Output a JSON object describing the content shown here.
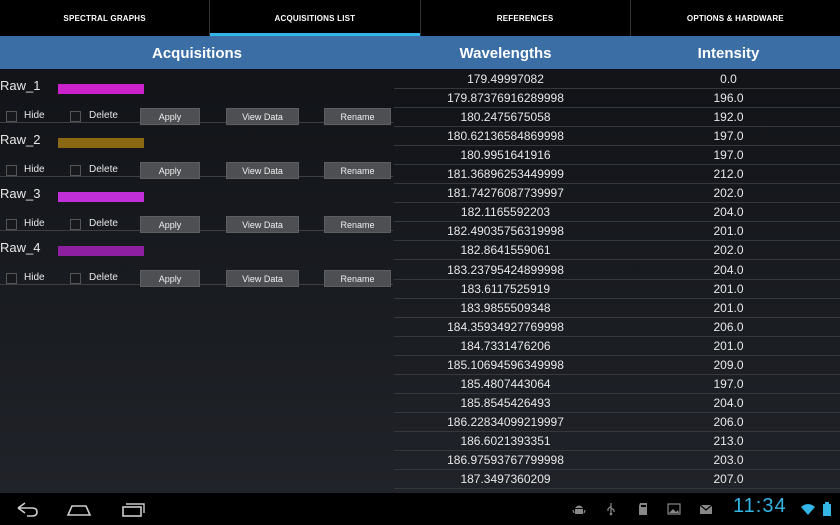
{
  "tabs": [
    {
      "label": "SPECTRAL GRAPHS",
      "active": false
    },
    {
      "label": "ACQUISITIONS LIST",
      "active": true
    },
    {
      "label": "REFERENCES",
      "active": false
    },
    {
      "label": "OPTIONS & HARDWARE",
      "active": false
    }
  ],
  "headers": {
    "acquisitions": "Acquisitions",
    "wavelengths": "Wavelengths",
    "intensity": "Intensity"
  },
  "labels": {
    "hide": "Hide",
    "delete": "Delete",
    "apply": "Apply",
    "view_data": "View Data",
    "rename": "Rename"
  },
  "acquisitions": [
    {
      "name": "Raw_1",
      "color": "#cc22cc"
    },
    {
      "name": "Raw_2",
      "color": "#8b6914"
    },
    {
      "name": "Raw_3",
      "color": "#c02fd8"
    },
    {
      "name": "Raw_4",
      "color": "#8e1fa0"
    }
  ],
  "table_rows": [
    {
      "wavelength": "179.49997082",
      "intensity": "0.0"
    },
    {
      "wavelength": "179.87376916289998",
      "intensity": "196.0"
    },
    {
      "wavelength": "180.2475675058",
      "intensity": "192.0"
    },
    {
      "wavelength": "180.62136584869998",
      "intensity": "197.0"
    },
    {
      "wavelength": "180.9951641916",
      "intensity": "197.0"
    },
    {
      "wavelength": "181.36896253449999",
      "intensity": "212.0"
    },
    {
      "wavelength": "181.74276087739997",
      "intensity": "202.0"
    },
    {
      "wavelength": "182.1165592203",
      "intensity": "204.0"
    },
    {
      "wavelength": "182.49035756319998",
      "intensity": "201.0"
    },
    {
      "wavelength": "182.8641559061",
      "intensity": "202.0"
    },
    {
      "wavelength": "183.23795424899998",
      "intensity": "204.0"
    },
    {
      "wavelength": "183.6117525919",
      "intensity": "201.0"
    },
    {
      "wavelength": "183.9855509348",
      "intensity": "201.0"
    },
    {
      "wavelength": "184.35934927769998",
      "intensity": "206.0"
    },
    {
      "wavelength": "184.7331476206",
      "intensity": "201.0"
    },
    {
      "wavelength": "185.10694596349998",
      "intensity": "209.0"
    },
    {
      "wavelength": "185.4807443064",
      "intensity": "197.0"
    },
    {
      "wavelength": "185.8545426493",
      "intensity": "204.0"
    },
    {
      "wavelength": "186.22834099219997",
      "intensity": "206.0"
    },
    {
      "wavelength": "186.6021393351",
      "intensity": "213.0"
    },
    {
      "wavelength": "186.97593767799998",
      "intensity": "203.0"
    },
    {
      "wavelength": "187.3497360209",
      "intensity": "207.0"
    }
  ],
  "system_bar": {
    "clock": "11:34",
    "accent_color": "#33b5e5",
    "nav_icons": [
      "back-icon",
      "home-icon",
      "recent-apps-icon"
    ],
    "status_icons": [
      "android-debug-icon",
      "usb-icon",
      "sd-card-icon",
      "gallery-icon",
      "gmail-icon"
    ]
  }
}
